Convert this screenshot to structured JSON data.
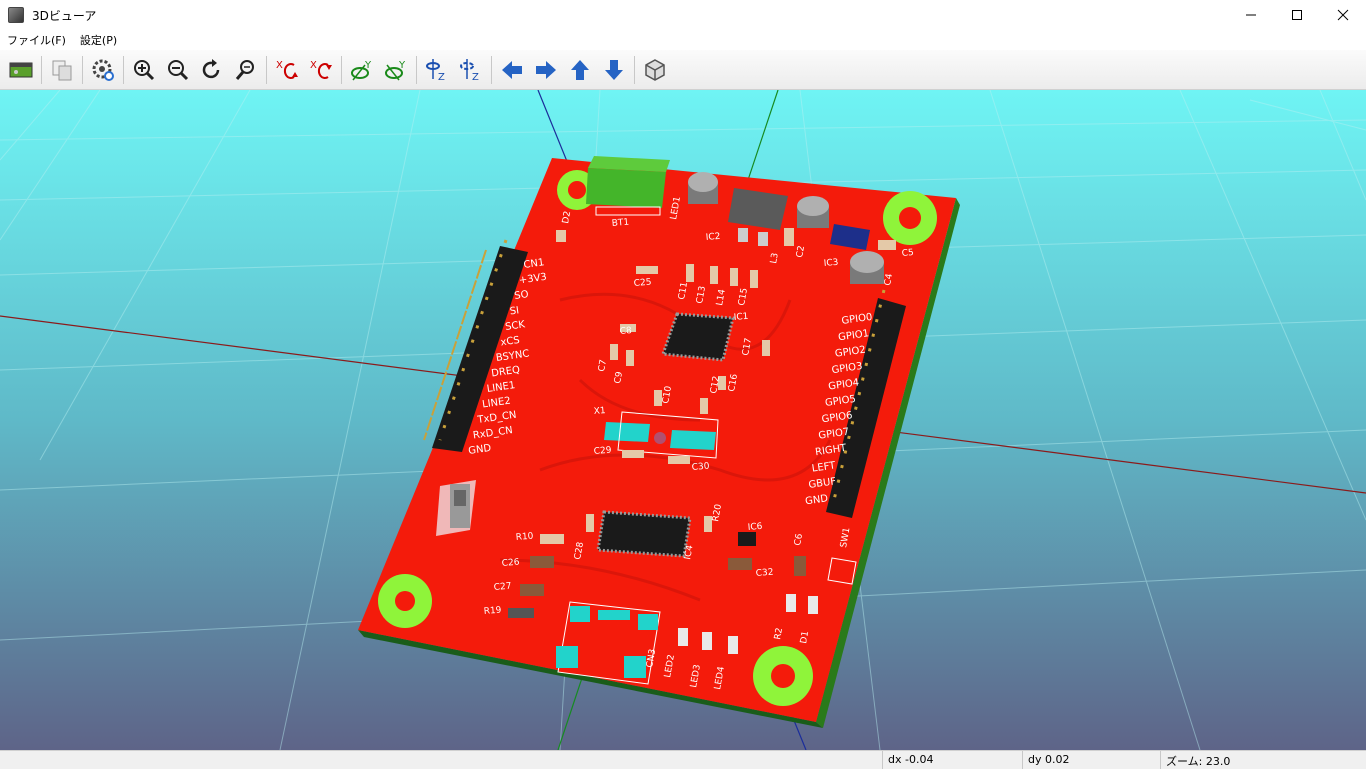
{
  "window": {
    "title": "3Dビューア",
    "minimize": "—",
    "maximize": "☐",
    "close": "✕"
  },
  "menu": {
    "file": "ファイル(F)",
    "settings": "設定(P)"
  },
  "toolbar": {
    "buttons": [
      "reload-board",
      "copy-image",
      "settings",
      "zoom-in",
      "zoom-out",
      "redraw",
      "zoom-fit",
      "rotate-x-cw",
      "rotate-x-ccw",
      "rotate-y-cw",
      "rotate-y-ccw",
      "rotate-z-cw",
      "rotate-z-ccw",
      "pan-left",
      "pan-right",
      "pan-up",
      "pan-down",
      "toggle-orthographic"
    ]
  },
  "status": {
    "dx": "dx -0.04",
    "dy": "dy 0.02",
    "zoom": "ズーム: 23.0"
  },
  "board": {
    "left_labels": [
      "CN1",
      "+3V3",
      "SO",
      "SI",
      "SCK",
      "xCS",
      "BSYNC",
      "DREQ",
      "LINE1",
      "LINE2",
      "TxD_CN",
      "RxD_CN",
      "GND"
    ],
    "right_labels": [
      "GPIO0",
      "GPIO1",
      "GPIO2",
      "GPIO3",
      "GPIO4",
      "GPIO5",
      "GPIO6",
      "GPIO7",
      "RIGHT",
      "LEFT",
      "GBUF",
      "GND"
    ],
    "refs": [
      "BT1",
      "LED1",
      "IC2",
      "L3",
      "C2",
      "IC3",
      "C5",
      "C4",
      "C25",
      "C11",
      "C13",
      "L14",
      "C15",
      "IC1",
      "C8",
      "C17",
      "C7",
      "C9",
      "C10",
      "C12",
      "C16",
      "X1",
      "C29",
      "C30",
      "C28",
      "R20",
      "IC4",
      "IC6",
      "R10",
      "C26",
      "C27",
      "R19",
      "C32",
      "C6",
      "SW1",
      "CN3",
      "LED2",
      "LED3",
      "LED4",
      "R2",
      "D1",
      "D2"
    ]
  },
  "colors": {
    "board": "#f41b0b",
    "background_top": "#6ff4f4",
    "background_bottom": "#5e6488",
    "pad": "#22d3cb",
    "hole": "#8ff43a"
  }
}
